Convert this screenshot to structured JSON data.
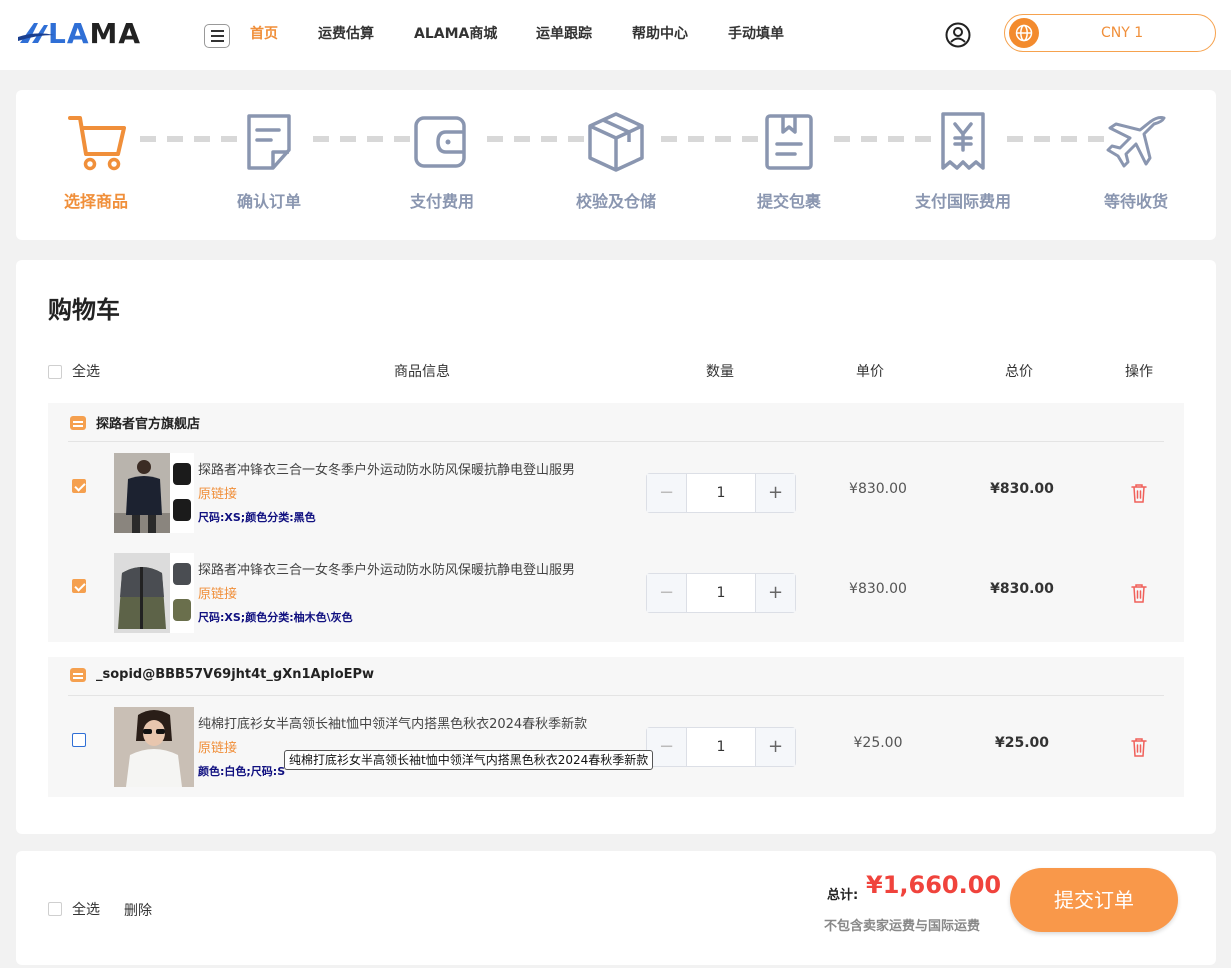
{
  "brand": {
    "logo_text_a": "LA",
    "logo_text_b": "MA"
  },
  "nav": {
    "items": [
      {
        "label": "首页",
        "active": true
      },
      {
        "label": "运费估算"
      },
      {
        "label": "ALAMA商城"
      },
      {
        "label": "运单跟踪"
      },
      {
        "label": "帮助中心"
      },
      {
        "label": "手动填单"
      }
    ]
  },
  "currency": {
    "label": "CNY 1"
  },
  "steps": [
    {
      "label": "选择商品",
      "icon": "cart-icon",
      "active": true
    },
    {
      "label": "确认订单",
      "icon": "document-icon"
    },
    {
      "label": "支付费用",
      "icon": "wallet-icon"
    },
    {
      "label": "校验及仓储",
      "icon": "box-icon"
    },
    {
      "label": "提交包裹",
      "icon": "clipboard-icon"
    },
    {
      "label": "支付国际费用",
      "icon": "receipt-icon"
    },
    {
      "label": "等待收货",
      "icon": "airplane-icon"
    }
  ],
  "cart": {
    "title": "购物车",
    "columns": {
      "select_all": "全选",
      "info": "商品信息",
      "qty": "数量",
      "unit": "单价",
      "total": "总价",
      "ops": "操作"
    },
    "stores": [
      {
        "name": "探路者官方旗舰店",
        "items": [
          {
            "name": "探路者冲锋衣三合一女冬季户外运动防水防风保暖抗静电登山服男",
            "link": "原链接",
            "spec": "尺码:XS;颜色分类:黑色",
            "qty": "1",
            "unit_price": "¥830.00",
            "total_price": "¥830.00",
            "checked": true
          },
          {
            "name": "探路者冲锋衣三合一女冬季户外运动防水防风保暖抗静电登山服男",
            "link": "原链接",
            "spec": "尺码:XS;颜色分类:柚木色\\灰色",
            "qty": "1",
            "unit_price": "¥830.00",
            "total_price": "¥830.00",
            "checked": true
          }
        ]
      },
      {
        "name": "_sopid@BBB57V69jht4t_gXn1ApIoEPw",
        "items": [
          {
            "name": "纯棉打底衫女半高领长袖t恤中领洋气内搭黑色秋衣2024春秋季新款",
            "link": "原链接",
            "spec": "颜色:白色;尺码:S",
            "qty": "1",
            "unit_price": "¥25.00",
            "total_price": "¥25.00",
            "checked": false
          }
        ]
      }
    ],
    "tooltip": "纯棉打底衫女半高领长袖t恤中领洋气内搭黑色秋衣2024春秋季新款"
  },
  "footer": {
    "select_all": "全选",
    "delete": "删除",
    "total_label": "总计:",
    "total_value": "¥1,660.00",
    "note": "不包含卖家运费与国际运费",
    "submit": "提交订单"
  },
  "colors": {
    "accent": "#f08f3a",
    "price_red": "#f0433c",
    "step_gray": "#8a96b0",
    "brand_blue": "#2f6fd6"
  }
}
